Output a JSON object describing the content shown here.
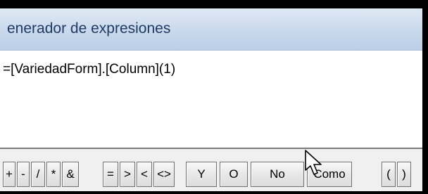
{
  "window": {
    "title": "enerador de expresiones"
  },
  "expression": {
    "value": "=[VariedadForm].[Column](1)"
  },
  "operators": {
    "group1": [
      "+",
      "-",
      "/",
      "*",
      "&"
    ],
    "group2": [
      "=",
      ">",
      "<",
      "<>"
    ],
    "y": "Y",
    "o": "O",
    "no": "No",
    "como": "Como",
    "parens": [
      "(",
      ")"
    ]
  },
  "icons": {
    "cursor": "mouse-pointer-icon"
  }
}
